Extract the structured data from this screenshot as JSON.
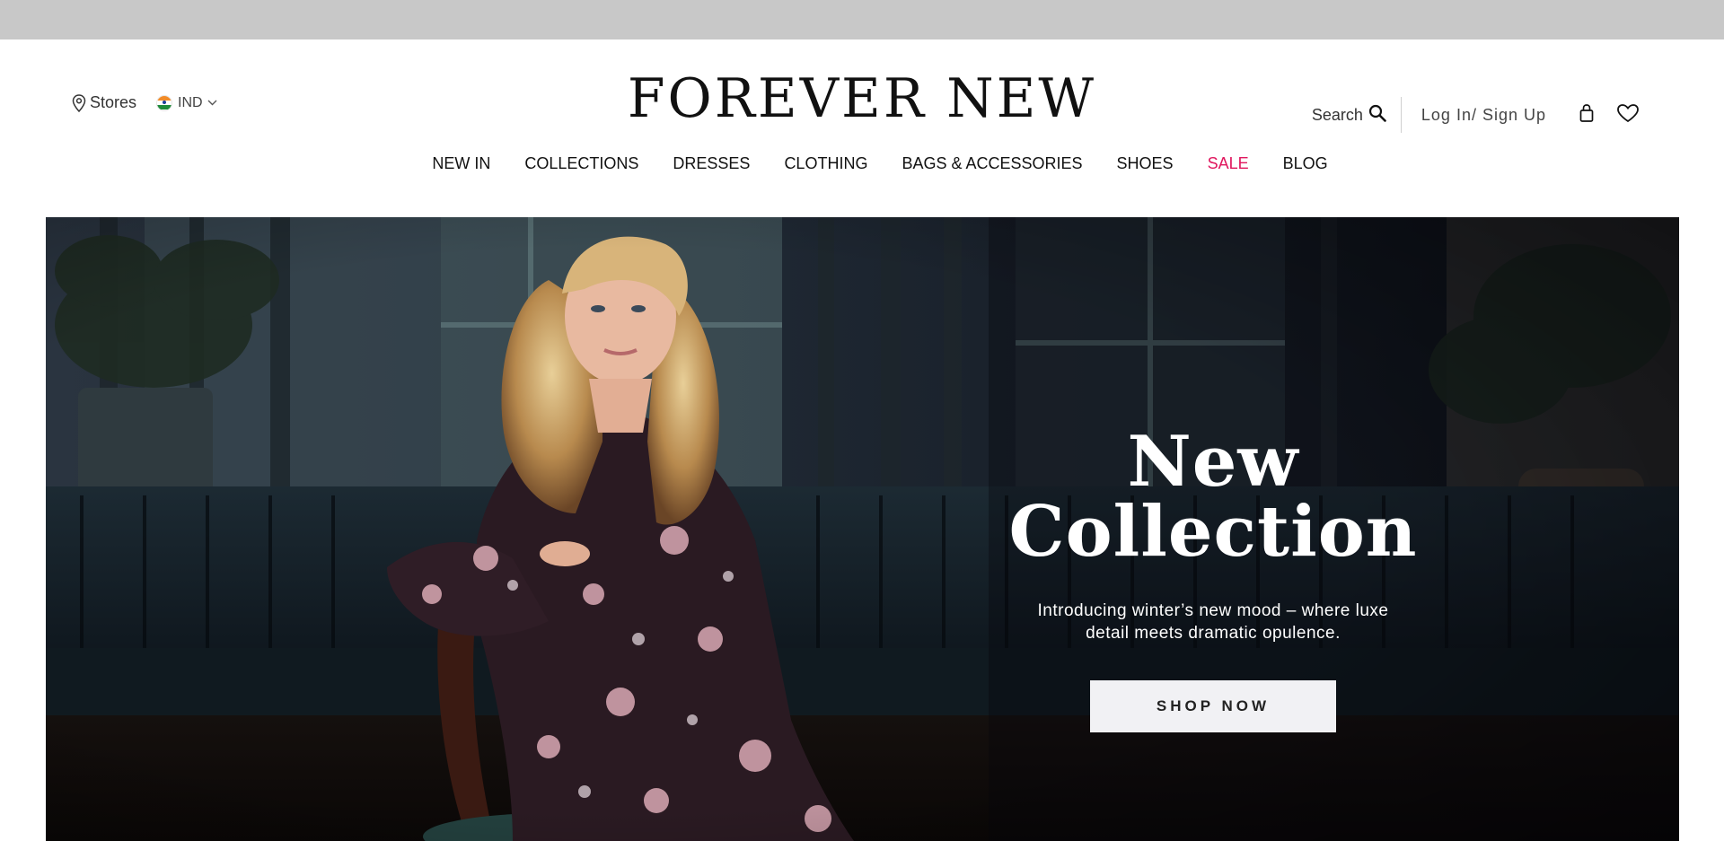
{
  "header": {
    "stores_label": "Stores",
    "country_code": "IND",
    "logo_text": "FOREVER NEW",
    "search_label": "Search",
    "login_label": "Log In/ Sign Up"
  },
  "nav": {
    "items": [
      {
        "label": "NEW IN"
      },
      {
        "label": "COLLECTIONS"
      },
      {
        "label": "DRESSES"
      },
      {
        "label": "CLOTHING"
      },
      {
        "label": "BAGS & ACCESSORIES"
      },
      {
        "label": "SHOES"
      },
      {
        "label": "SALE"
      },
      {
        "label": "BLOG"
      }
    ]
  },
  "hero": {
    "title": "New Collection",
    "subtitle": "Introducing winter’s new mood – where luxe detail meets dramatic opulence.",
    "cta_label": "SHOP NOW"
  },
  "icons": {
    "stores": "map-pin-icon",
    "country_flag": "india-flag-icon",
    "country_dropdown": "chevron-down-icon",
    "search": "search-icon",
    "bag": "shopping-bag-icon",
    "wishlist": "heart-icon"
  },
  "colors": {
    "topbar": "#c8c8c8",
    "sale": "#e0165d",
    "cta_background": "#f1f1f4",
    "hero_text": "#ffffff"
  }
}
